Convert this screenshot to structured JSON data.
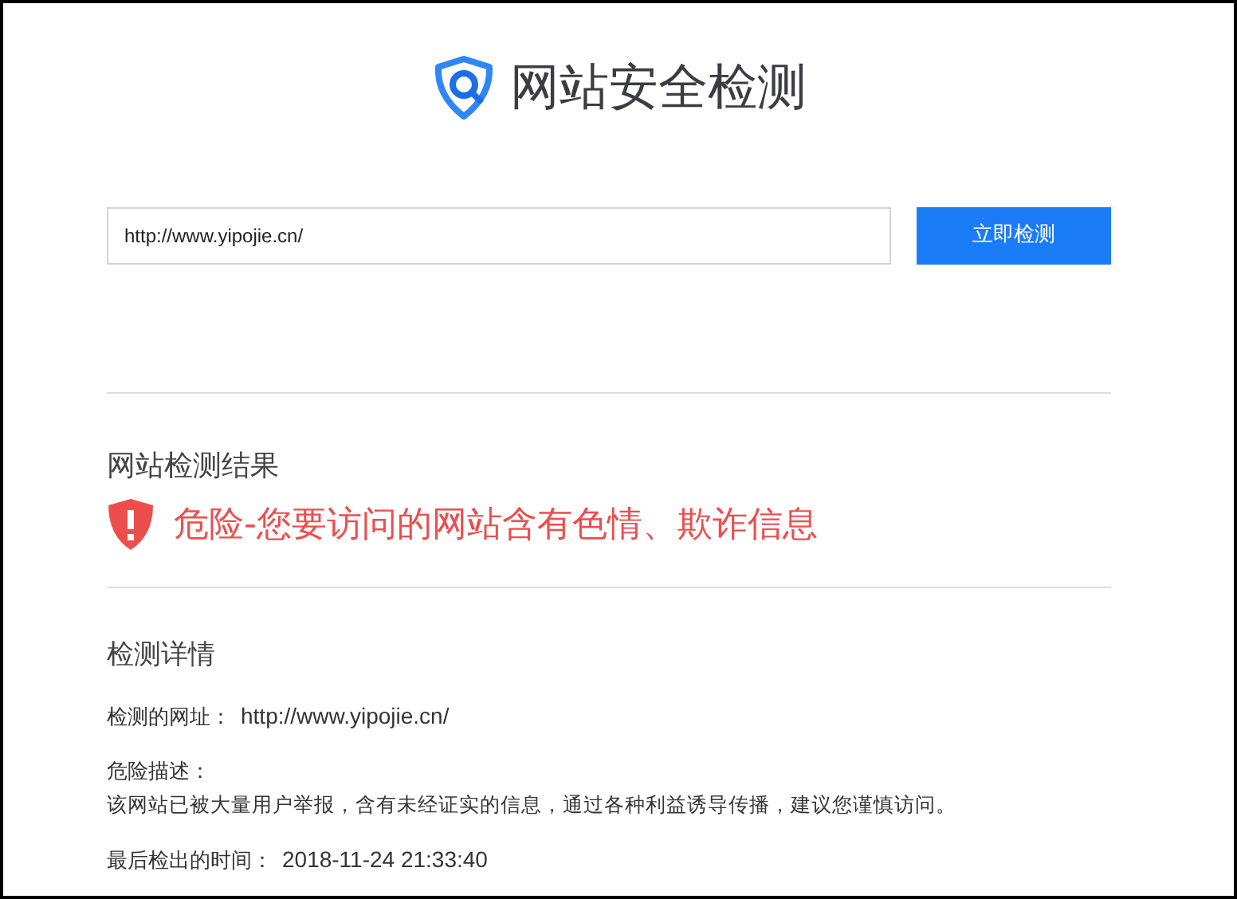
{
  "header": {
    "title": "网站安全检测"
  },
  "search": {
    "value": "http://www.yipojie.cn/",
    "button": "立即检测"
  },
  "result": {
    "heading": "网站检测结果",
    "kind": "danger",
    "message": "危险-您要访问的网站含有色情、欺诈信息"
  },
  "details": {
    "heading": "检测详情",
    "items": [
      {
        "kind": "inline",
        "label": "检测的网址：",
        "value": "http://www.yipojie.cn/"
      },
      {
        "kind": "block",
        "label": "危险描述：",
        "value": "该网站已被大量用户举报，含有未经证实的信息，通过各种利益诱导传播，建议您谨慎访问。"
      },
      {
        "kind": "inline",
        "label": "最后检出的时间：",
        "value": "2018-11-24 21:33:40"
      }
    ]
  }
}
